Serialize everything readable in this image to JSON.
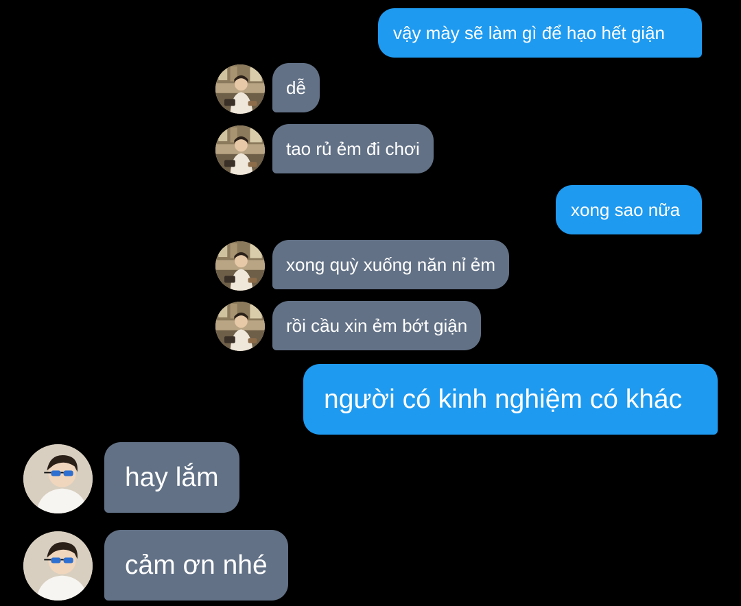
{
  "messages": [
    {
      "id": "m1",
      "from": "me",
      "text": "vậy mày sẽ làm gì để hạo hết giận"
    },
    {
      "id": "m2",
      "from": "friend_a",
      "text": "dễ"
    },
    {
      "id": "m3",
      "from": "friend_a",
      "text": "tao rủ ẻm đi chơi"
    },
    {
      "id": "m4",
      "from": "me",
      "text": "xong sao nữa"
    },
    {
      "id": "m5",
      "from": "friend_a",
      "text": "xong quỳ xuống năn nỉ ẻm"
    },
    {
      "id": "m6",
      "from": "friend_a",
      "text": "rồi cầu xin ẻm bớt giận"
    },
    {
      "id": "m7",
      "from": "me",
      "text": "người có kinh nghiệm có khác"
    },
    {
      "id": "m8",
      "from": "friend_b",
      "text": "hay lắm"
    },
    {
      "id": "m9",
      "from": "friend_b",
      "text": "cảm ơn nhé"
    }
  ],
  "colors": {
    "background": "#000000",
    "sent_bubble": "#1e9af0",
    "received_bubble": "#627186",
    "text": "#ffffff"
  },
  "icons": {
    "friend_a_avatar": "avatar-cafe-photo-icon",
    "friend_b_avatar": "avatar-sunglasses-photo-icon"
  }
}
